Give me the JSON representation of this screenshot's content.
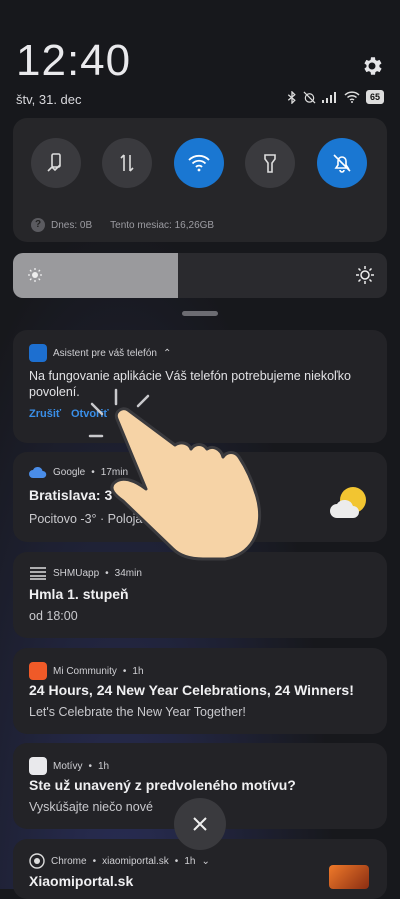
{
  "status": {
    "time": "12:40",
    "date": "štv, 31. dec",
    "battery": "65"
  },
  "quick_settings": {
    "data_today": "Dnes: 0B",
    "data_month": "Tento mesiac: 16,26GB",
    "brightness_level": 0.44
  },
  "notifications": [
    {
      "app": "Asistent pre váš telefón",
      "text_line1": "Na fungovanie aplikácie Váš telefón potrebujeme niekoľko",
      "text_line2": "povolení.",
      "action_cancel": "Zrušiť",
      "action_open": "Otvoriť"
    },
    {
      "app": "Google",
      "time": "17min",
      "title": "Bratislava: 3°",
      "text": "Pocitovo -3° · Poloja"
    },
    {
      "app": "SHMUapp",
      "time": "34min",
      "title": "Hmla 1. stupeň",
      "text": "od 18:00"
    },
    {
      "app": "Mi Community",
      "time": "1h",
      "title": "24 Hours, 24 New Year Celebrations, 24 Winners!",
      "text": "Let's Celebrate the New Year Together!"
    },
    {
      "app": "Motívy",
      "time": "1h",
      "title": "Ste už unavený z predvoleného motívu?",
      "text": "Vyskúšajte niečo nové"
    },
    {
      "app": "Chrome",
      "source": "xiaomiportal.sk",
      "time": "1h",
      "title": "Xiaomiportal.sk"
    }
  ],
  "colors": {
    "accent": "#1a77d2",
    "link": "#3a8fe8"
  }
}
